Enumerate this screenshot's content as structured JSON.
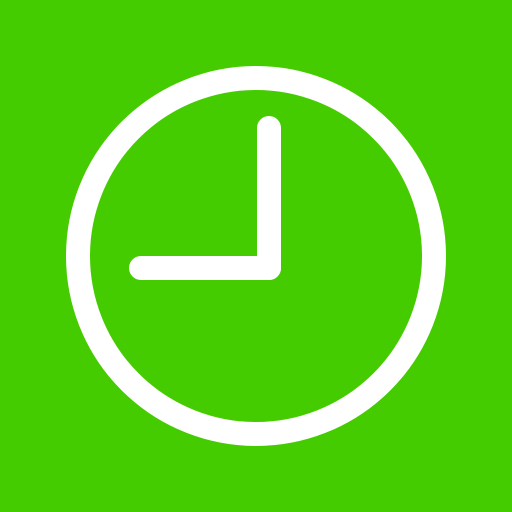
{
  "icon": {
    "name": "clock-icon",
    "background_color": "#44cc00",
    "foreground_color": "#ffffff",
    "time_shown": "9:00"
  }
}
